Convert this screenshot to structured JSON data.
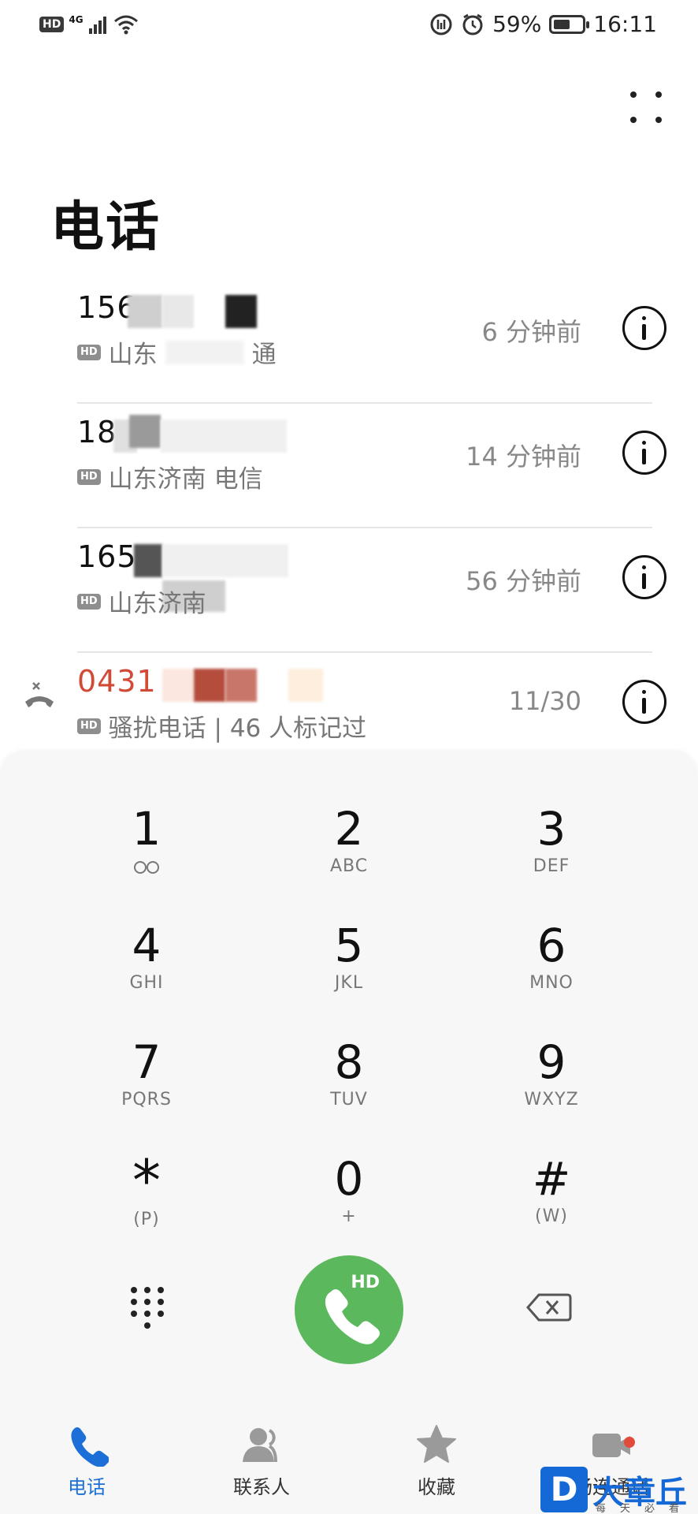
{
  "status_bar": {
    "hd": "HD",
    "network": "4G",
    "battery": "59%",
    "battery_level": 0.59,
    "time": "16:11"
  },
  "header": {
    "title": "电话",
    "more_icon": "more-dots-icon"
  },
  "calls": [
    {
      "number": "156",
      "location": "山东",
      "carrier_tail": "通",
      "time": "6 分钟前",
      "type": "normal",
      "hd": "HD"
    },
    {
      "number": "18",
      "location": "山东济南",
      "carrier_tail": "电信",
      "time": "14 分钟前",
      "type": "normal",
      "hd": "HD"
    },
    {
      "number": "165",
      "location": "山东济南",
      "carrier_tail": "",
      "time": "56 分钟前",
      "type": "normal",
      "hd": "HD"
    },
    {
      "number": "0431",
      "location": "骚扰电话 | 46 人标记过",
      "carrier_tail": "",
      "time": "11/30",
      "type": "missed",
      "hd": "HD"
    }
  ],
  "dialpad": {
    "keys": [
      {
        "digit": "1",
        "letters": ""
      },
      {
        "digit": "2",
        "letters": "ABC"
      },
      {
        "digit": "3",
        "letters": "DEF"
      },
      {
        "digit": "4",
        "letters": "GHI"
      },
      {
        "digit": "5",
        "letters": "JKL"
      },
      {
        "digit": "6",
        "letters": "MNO"
      },
      {
        "digit": "7",
        "letters": "PQRS"
      },
      {
        "digit": "8",
        "letters": "TUV"
      },
      {
        "digit": "9",
        "letters": "WXYZ"
      },
      {
        "digit": "*",
        "letters": "(P)"
      },
      {
        "digit": "0",
        "letters": "+"
      },
      {
        "digit": "#",
        "letters": "(W)"
      }
    ],
    "call_hd_label": "HD"
  },
  "bottom_nav": {
    "items": [
      {
        "label": "电话",
        "icon": "phone-icon",
        "active": true
      },
      {
        "label": "联系人",
        "icon": "contacts-icon",
        "active": false
      },
      {
        "label": "收藏",
        "icon": "star-icon",
        "active": false
      },
      {
        "label": "畅连通话",
        "icon": "video-call-icon",
        "active": false
      }
    ]
  },
  "watermark": {
    "logo": "D",
    "text": "大章丘",
    "sub": "每天必看"
  },
  "colors": {
    "accent": "#1b6fd6",
    "call_green": "#5cb85c",
    "missed_red": "#d24a36"
  }
}
